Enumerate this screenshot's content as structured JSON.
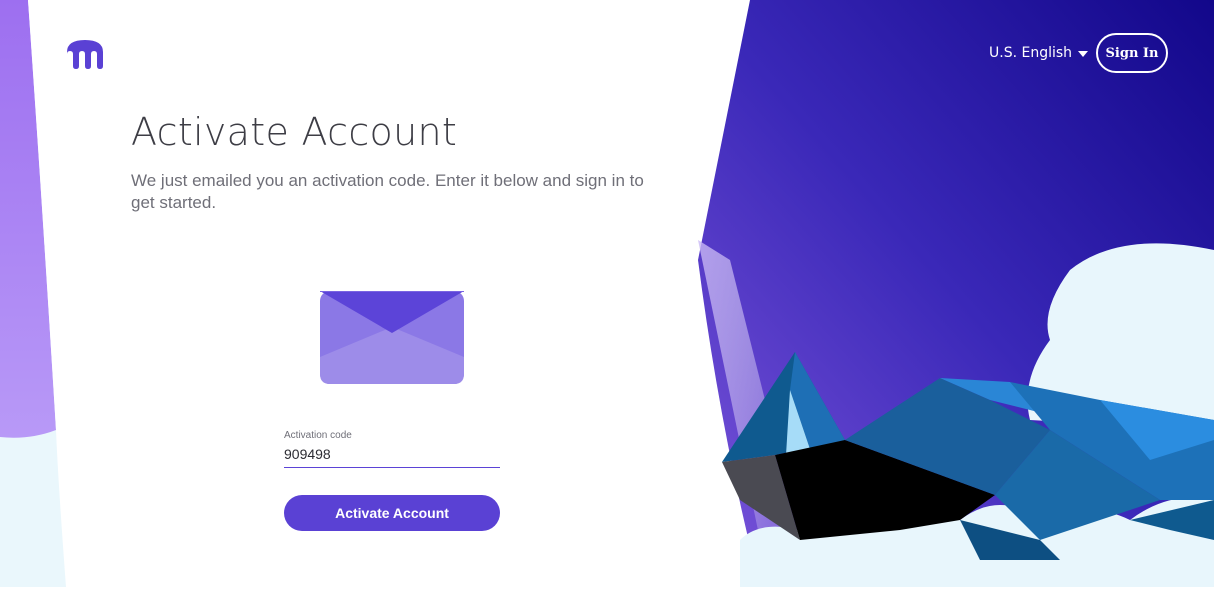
{
  "header": {
    "logo_icon": "kraken-logo-icon",
    "language_label": "U.S. English",
    "signin_label": "Sign In"
  },
  "main": {
    "title": "Activate Account",
    "subtitle": "We just emailed you an activation code. Enter it below and sign in to get started.",
    "envelope_icon": "envelope-icon",
    "field": {
      "label": "Activation code",
      "value": "909498"
    },
    "submit_label": "Activate Account"
  },
  "colors": {
    "accent": "#5a41d4",
    "hero_top": "#1a0e8a",
    "hero_mid": "#6a4ad6",
    "cloud": "#e8f6fc"
  }
}
